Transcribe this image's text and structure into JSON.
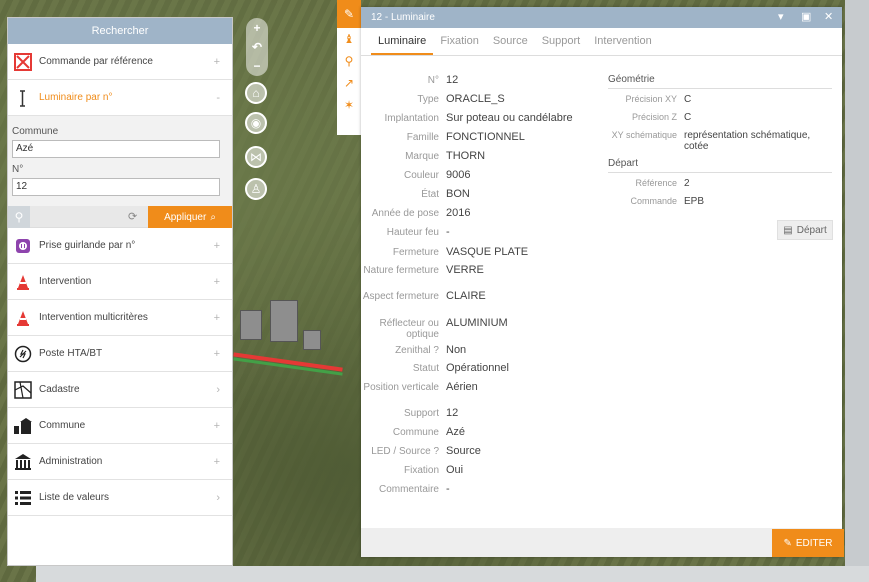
{
  "left_panel": {
    "title": "Rechercher",
    "items_top": [
      {
        "label": "Commande par référence",
        "sign": "+"
      },
      {
        "label": "Luminaire par n°",
        "sign": "-"
      }
    ],
    "form": {
      "commune_label": "Commune",
      "commune_value": "Azé",
      "num_label": "N°",
      "num_value": "12",
      "apply_label": "Appliquer"
    },
    "items_bottom": [
      {
        "label": "Prise guirlande par n°",
        "sign": "+"
      },
      {
        "label": "Intervention",
        "sign": "+"
      },
      {
        "label": "Intervention multicritères",
        "sign": "+"
      },
      {
        "label": "Poste HTA/BT",
        "sign": "+"
      },
      {
        "label": "Cadastre",
        "sign": "›"
      },
      {
        "label": "Commune",
        "sign": "+"
      },
      {
        "label": "Administration",
        "sign": "+"
      },
      {
        "label": "Liste de valeurs",
        "sign": "›"
      }
    ]
  },
  "detail": {
    "title": "12 - Luminaire",
    "tabs": [
      "Luminaire",
      "Fixation",
      "Source",
      "Support",
      "Intervention"
    ],
    "fields": [
      {
        "label": "N°",
        "value": "12"
      },
      {
        "label": "Type",
        "value": "ORACLE_S"
      },
      {
        "label": "Implantation",
        "value": "Sur poteau ou candélabre"
      },
      {
        "label": "Famille",
        "value": "FONCTIONNEL"
      },
      {
        "label": "Marque",
        "value": "THORN"
      },
      {
        "label": "Couleur",
        "value": "9006"
      },
      {
        "label": "État",
        "value": "BON"
      },
      {
        "label": "Année de pose",
        "value": "2016"
      },
      {
        "label": "Hauteur feu",
        "value": "-"
      },
      {
        "label": "Fermeture",
        "value": "VASQUE PLATE"
      },
      {
        "label": "Nature fermeture",
        "value": "VERRE"
      },
      {
        "label": "Aspect fermeture",
        "value": "CLAIRE"
      },
      {
        "label": "Réflecteur ou optique",
        "value": "ALUMINIUM"
      },
      {
        "label": "Zenithal ?",
        "value": "Non"
      },
      {
        "label": "Statut",
        "value": "Opérationnel"
      },
      {
        "label": "Position verticale",
        "value": "Aérien"
      },
      {
        "label": "Support",
        "value": "12"
      },
      {
        "label": "Commune",
        "value": "Azé"
      },
      {
        "label": "LED / Source ?",
        "value": "Source"
      },
      {
        "label": "Fixation",
        "value": "Oui"
      },
      {
        "label": "Commentaire",
        "value": "-"
      }
    ],
    "geometrie": {
      "title": "Géométrie",
      "rows": [
        {
          "label": "Précision XY",
          "value": "C"
        },
        {
          "label": "Précision Z",
          "value": "C"
        },
        {
          "label": "XY schématique",
          "value": "représentation schématique, cotée"
        }
      ]
    },
    "depart": {
      "title": "Départ",
      "rows": [
        {
          "label": "Référence",
          "value": "2"
        },
        {
          "label": "Commande",
          "value": "EPB"
        }
      ],
      "button_label": "Départ"
    },
    "edit_label": "EDITER"
  },
  "colors": {
    "accent": "#f08c1a",
    "header": "#9fb4c8"
  }
}
